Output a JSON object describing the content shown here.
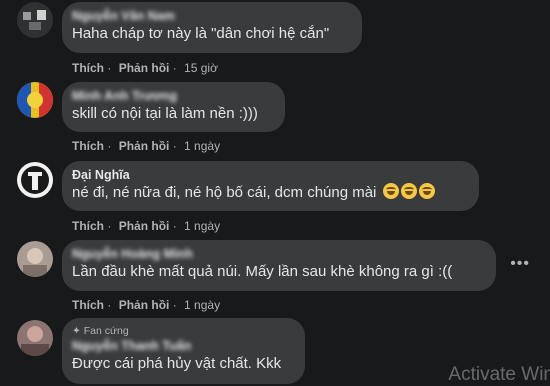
{
  "comments": [
    {
      "author": "Nguyễn Văn Nam",
      "text": "Haha cháp tơ này là \"dân chơi hệ cắn\"",
      "like_label": "Thích",
      "reply_label": "Phản hồi",
      "time": "15 giờ"
    },
    {
      "author": "Minh Anh Trương",
      "text": "skill có nội tại là làm nền :)))",
      "like_label": "Thích",
      "reply_label": "Phản hồi",
      "time": "1 ngày"
    },
    {
      "author": "Đại Nghĩa",
      "text": "né đi, né nữa đi, né hộ bố cái, dcm chúng mài",
      "like_label": "Thích",
      "reply_label": "Phản hồi",
      "time": "1 ngày"
    },
    {
      "author": "Nguyễn Hoàng Minh",
      "text": "Lần đầu khè mất quả núi. Mấy lần sau khè không ra gì :((",
      "like_label": "Thích",
      "reply_label": "Phản hồi",
      "time": "1 ngày"
    },
    {
      "badge": "Fan cứng",
      "author": "Nguyễn Thanh Tuấn",
      "text": "Được cái phá hủy vật chất. Kkk"
    }
  ],
  "more_icon": "ellipsis-icon",
  "watermark": "Activate Win"
}
